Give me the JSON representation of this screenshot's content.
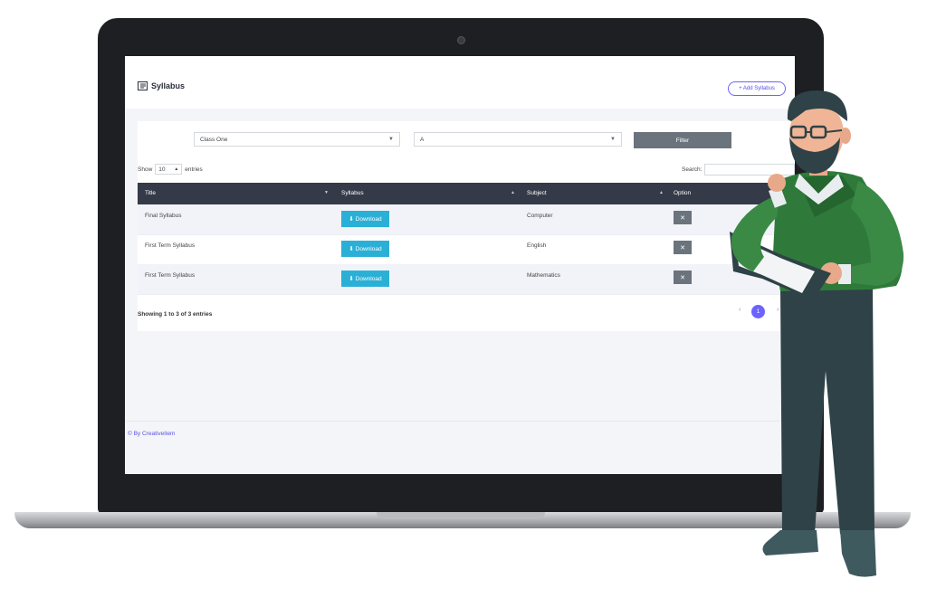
{
  "header": {
    "title": "Syllabus",
    "add_button": "+ Add Syllabus"
  },
  "filters": {
    "class_select": "Class One",
    "section_select": "A",
    "filter_button": "Filter"
  },
  "table_controls": {
    "show_label": "Show",
    "entries_value": "10",
    "entries_label": "entries",
    "search_label": "Search:"
  },
  "table": {
    "columns": [
      "Title",
      "Syllabus",
      "Subject",
      "Option"
    ],
    "rows": [
      {
        "title": "Final Syllabus",
        "syllabus": "⬇ Download",
        "subject": "Computer",
        "option": "✕"
      },
      {
        "title": "First Term Syllabus",
        "syllabus": "⬇ Download",
        "subject": "English",
        "option": "✕"
      },
      {
        "title": "First Term Syllabus",
        "syllabus": "⬇ Download",
        "subject": "Mathematics",
        "option": "✕"
      }
    ]
  },
  "pagination": {
    "info": "Showing 1 to 3 of 3 entries",
    "prev": "‹",
    "current": "1",
    "next": "›"
  },
  "footer": {
    "text": "© By Creativeitem"
  },
  "colors": {
    "accent": "#6c63ff",
    "table_header": "#343a47",
    "download_button": "#2ab0d6",
    "secondary_button": "#6b747d"
  },
  "icons": [
    "syllabus-list-icon",
    "chevron-down-icon",
    "sort-icon",
    "download-icon",
    "close-icon"
  ]
}
